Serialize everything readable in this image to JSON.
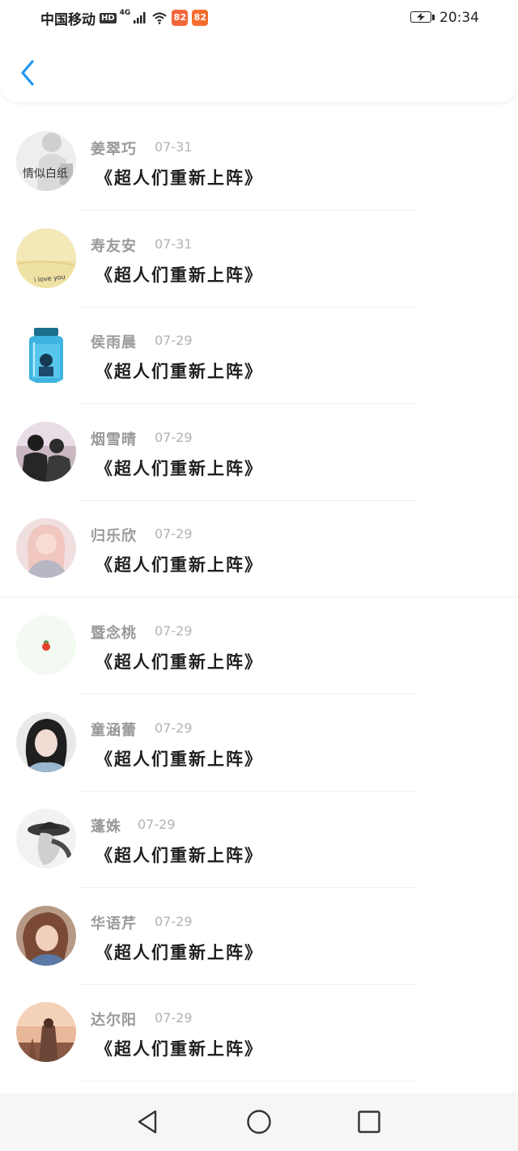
{
  "status_bar": {
    "carrier": "中国移动",
    "hd_badge": "HD",
    "network_badge": "4G",
    "app_icon_1": "82",
    "app_icon_2": "82",
    "time": "20:34"
  },
  "nav": {
    "back_icon": "chevron-left-icon",
    "accent_color": "#2196f3"
  },
  "comments": [
    {
      "name": "姜翠巧",
      "date": "07-31",
      "title": "《超人们重新上阵》",
      "avatar_text": "情似白纸",
      "avatar_icon": "avatar-photo-icon"
    },
    {
      "name": "寿友安",
      "date": "07-31",
      "title": "《超人们重新上阵》",
      "avatar_text": "i love you",
      "avatar_icon": "avatar-photo-icon"
    },
    {
      "name": "侯雨晨",
      "date": "07-29",
      "title": "《超人们重新上阵》",
      "avatar_icon": "avatar-bottle-icon"
    },
    {
      "name": "烟雪晴",
      "date": "07-29",
      "title": "《超人们重新上阵》",
      "avatar_icon": "avatar-photo-icon"
    },
    {
      "name": "归乐欣",
      "date": "07-29",
      "title": "《超人们重新上阵》",
      "avatar_icon": "avatar-photo-icon"
    },
    {
      "name": "暨念桃",
      "date": "07-29",
      "title": "《超人们重新上阵》",
      "avatar_icon": "avatar-tomato-icon"
    },
    {
      "name": "童涵蕾",
      "date": "07-29",
      "title": "《超人们重新上阵》",
      "avatar_icon": "avatar-photo-icon"
    },
    {
      "name": "蓬姝",
      "date": "07-29",
      "title": "《超人们重新上阵》",
      "avatar_icon": "avatar-photo-icon"
    },
    {
      "name": "华语芹",
      "date": "07-29",
      "title": "《超人们重新上阵》",
      "avatar_icon": "avatar-photo-icon"
    },
    {
      "name": "达尔阳",
      "date": "07-29",
      "title": "《超人们重新上阵》",
      "avatar_icon": "avatar-photo-icon"
    }
  ],
  "system_nav": {
    "back_icon": "triangle-back-icon",
    "home_icon": "circle-home-icon",
    "recents_icon": "square-recents-icon"
  }
}
